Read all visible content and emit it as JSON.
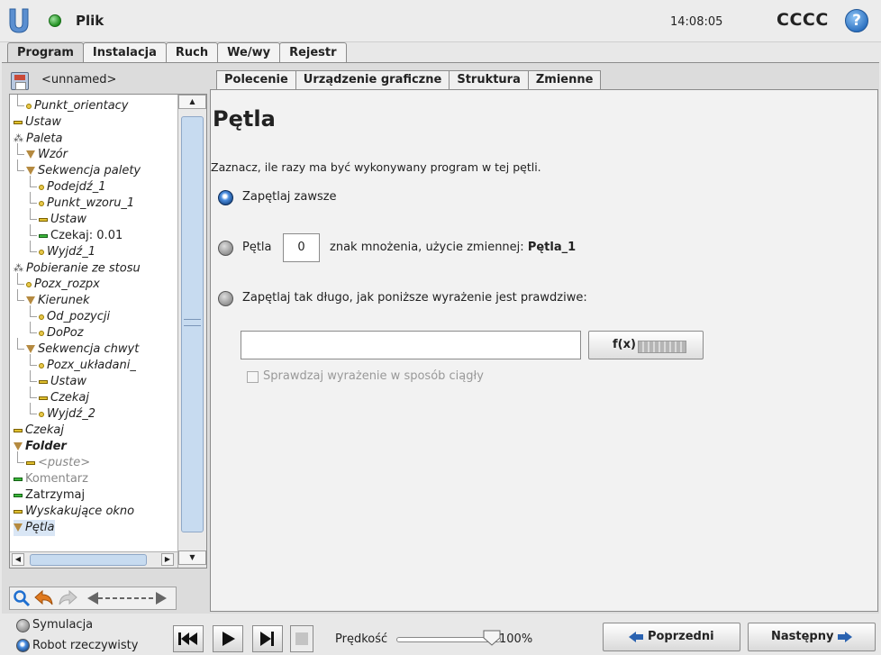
{
  "titlebar": {
    "app_title": "Plik",
    "clock": "14:08:05",
    "robot_name": "CCCC",
    "help_label": "?"
  },
  "main_tabs": [
    "Program",
    "Instalacja",
    "Ruch",
    "We/wy",
    "Rejestr"
  ],
  "file": {
    "name": "<unnamed>"
  },
  "tree": [
    {
      "label": "Punkt_orientacy",
      "marker": "dot"
    },
    {
      "label": "Ustaw",
      "marker": "dash"
    },
    {
      "label": "Paleta",
      "marker": "pallet"
    },
    {
      "label": "Wzór",
      "marker": "triangle"
    },
    {
      "label": "Sekwencja palety",
      "marker": "triangle"
    },
    {
      "label": "Podejdź_1",
      "marker": "dot"
    },
    {
      "label": "Punkt_wzoru_1",
      "marker": "dot"
    },
    {
      "label": "Ustaw",
      "marker": "dash"
    },
    {
      "label": "Czekaj: 0.01",
      "marker": "dash-green"
    },
    {
      "label": "Wyjdź_1",
      "marker": "dot"
    },
    {
      "label": "Pobieranie ze stosu",
      "marker": "pallet"
    },
    {
      "label": "Pozx_rozpx",
      "marker": "dot"
    },
    {
      "label": "Kierunek",
      "marker": "triangle"
    },
    {
      "label": "Od_pozycji",
      "marker": "dot"
    },
    {
      "label": "DoPoz",
      "marker": "dot"
    },
    {
      "label": "Sekwencja chwyt",
      "marker": "triangle"
    },
    {
      "label": "Pozx_układani_",
      "marker": "dot"
    },
    {
      "label": "Ustaw",
      "marker": "dash"
    },
    {
      "label": "Czekaj",
      "marker": "dash"
    },
    {
      "label": "Wyjdź_2",
      "marker": "dot"
    },
    {
      "label": "Czekaj",
      "marker": "dash"
    },
    {
      "label": "Folder",
      "marker": "triangle"
    },
    {
      "label": "<puste>",
      "marker": "dash"
    },
    {
      "label": "Komentarz",
      "marker": "dash-green"
    },
    {
      "label": "Zatrzymaj",
      "marker": "dash-green"
    },
    {
      "label": "Wyskakujące okno",
      "marker": "dash"
    },
    {
      "label": "Pętla",
      "marker": "triangle"
    }
  ],
  "sub_tabs": [
    "Polecenie",
    "Urządzenie graficzne",
    "Struktura",
    "Zmienne"
  ],
  "loop": {
    "heading": "Pętla",
    "description": "Zaznacz, ile razy ma być wykonywany program w tej pętli.",
    "option_always": "Zapętlaj zawsze",
    "option_count_prefix": "Pętla",
    "count_value": "0",
    "option_count_suffix": "znak mnożenia, użycie zmiennej:",
    "count_variable": "Pętla_1",
    "option_while": "Zapętlaj tak długo, jak poniższe wyrażenie jest prawdziwe:",
    "expression_value": "",
    "fx_label": "f(x)",
    "continuous_label": "Sprawdzaj wyrażenie w sposób ciągły"
  },
  "bottom": {
    "mode_simulation": "Symulacja",
    "mode_real": "Robot rzeczywisty",
    "speed_label": "Prędkość",
    "speed_value": "100%",
    "speed_fraction": 1.0,
    "prev_label": "Poprzedni",
    "next_label": "Następny"
  },
  "colors": {
    "accent_blue": "#2a62b0",
    "status_green": "#1f8f1f",
    "marker_yellow": "#e0c030",
    "marker_green": "#3cb83c",
    "marker_triangle": "#b58a40"
  },
  "icons": [
    "ur-logo-icon",
    "status-dot-icon",
    "help-icon",
    "save-icon",
    "search-icon",
    "undo-icon",
    "redo-icon",
    "move-arrows-icon",
    "skip-back-icon",
    "play-icon",
    "step-forward-icon",
    "stop-icon",
    "keyboard-icon",
    "arrow-left-icon",
    "arrow-right-icon"
  ]
}
